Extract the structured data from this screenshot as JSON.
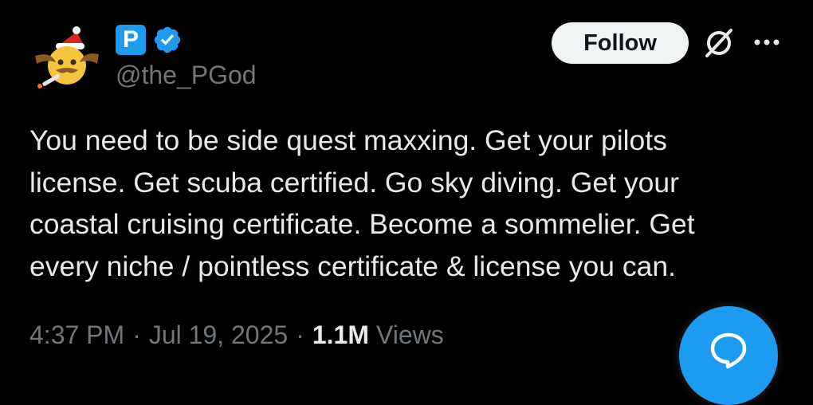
{
  "author": {
    "avatar_icon": "cowboy-santa-emoji-avatar",
    "affiliate_badge_letter": "P",
    "verified_icon": "verified-badge-icon",
    "handle": "@the_PGod"
  },
  "actions": {
    "follow_label": "Follow",
    "grok_icon": "grok-icon",
    "more_icon": "more-options-icon"
  },
  "tweet": {
    "text": "You need to be side quest maxxing. Get your pilots\nlicense. Get scuba certified. Go sky diving. Get your\ncoastal cruising certificate. Become a sommelier. Get\nevery niche / pointless certificate & license you can."
  },
  "meta": {
    "time": "4:37 PM",
    "separator": "·",
    "date": "Jul 19, 2025",
    "views_count": "1.1M",
    "views_label": "Views"
  },
  "fab": {
    "icon": "reply-bubble-icon"
  },
  "colors": {
    "background": "#000000",
    "text": "#e7e9ea",
    "muted": "#71767b",
    "accent": "#1d9bf0",
    "button_bg": "#eff3f4"
  }
}
